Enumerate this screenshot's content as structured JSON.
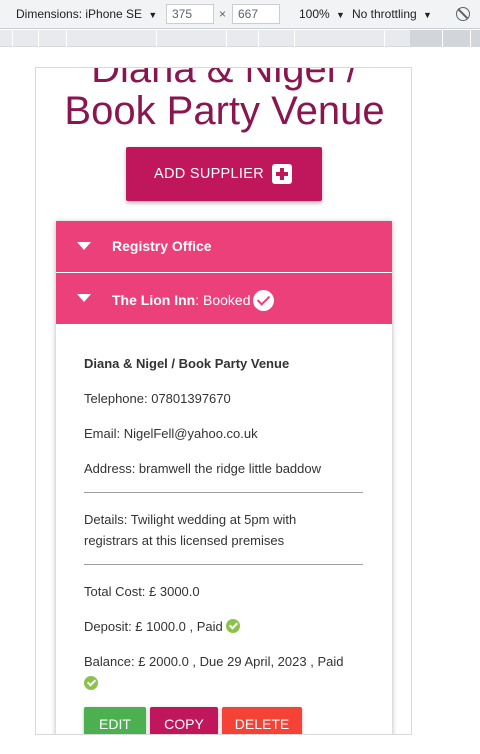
{
  "devtools": {
    "dimensions_label": "Dimensions: iPhone SE",
    "width_value": "375",
    "times": "×",
    "height_value": "667",
    "zoom": "100%",
    "throttling": "No throttling"
  },
  "page": {
    "title_line1": "Diana & Nigel /",
    "title_line2": "Book Party Venue",
    "add_supplier_label": "ADD SUPPLIER"
  },
  "accordion": {
    "item1_label": "Registry Office",
    "item2_label": "The Lion Inn",
    "item2_status": ": Booked"
  },
  "supplier": {
    "heading": "Diana & Nigel / Book Party Venue",
    "telephone": "Telephone: 07801397670",
    "email": "Email: NigelFell@yahoo.co.uk",
    "address": "Address: bramwell the ridge little baddow",
    "details_line1": "Details: Twilight wedding at 5pm with",
    "details_line2": "registrars at this licensed premises",
    "total_cost": "Total Cost: £ 3000.0",
    "deposit": "Deposit: £ 1000.0 , Paid",
    "balance": "Balance: £ 2000.0 , Due 29 April, 2023 , Paid"
  },
  "actions": {
    "edit_label": "EDIT",
    "copy_label": "COPY",
    "delete_label": "DELETE"
  },
  "colors": {
    "title": "#8a1650",
    "primary": "#c0175c",
    "accordion": "#ec407a",
    "edit": "#4caf50",
    "delete": "#f44336",
    "paid": "#8bc34a"
  }
}
